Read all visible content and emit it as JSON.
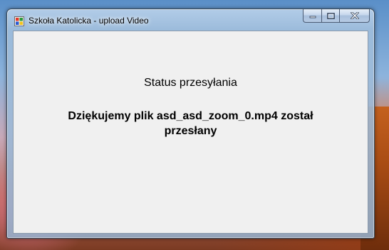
{
  "window": {
    "title": "Szkoła Katolicka - upload Video",
    "icon": "application-icon"
  },
  "titlebar_controls": [
    {
      "name": "minimize-button",
      "icon": "minimize-icon"
    },
    {
      "name": "maximize-button",
      "icon": "maximize-icon"
    },
    {
      "name": "close-button",
      "icon": "close-icon"
    }
  ],
  "content": {
    "status_heading": "Status przesyłania",
    "message": "Dziękujemy plik asd_asd_zoom_0.mp4 został przesłany"
  },
  "colors": {
    "client_background": "#f0f0f0",
    "titlebar": "#b9d1ea"
  }
}
